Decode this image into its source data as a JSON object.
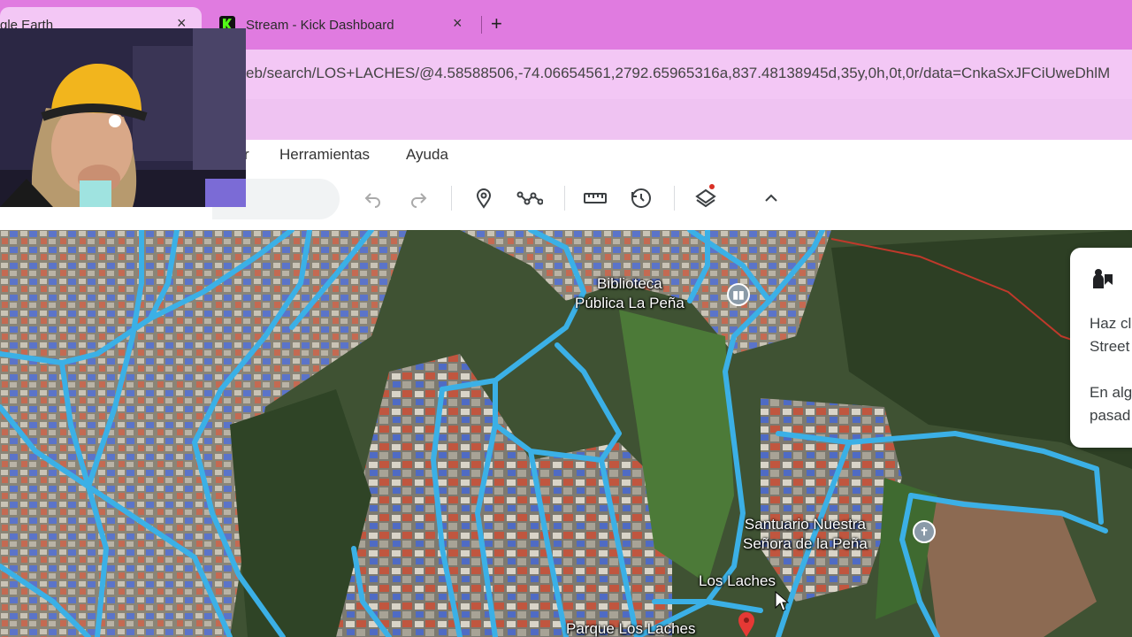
{
  "browser": {
    "tabs": [
      {
        "title": "gle Earth",
        "active": true
      },
      {
        "title": "Stream - Kick Dashboard",
        "active": false
      }
    ],
    "new_tab_glyph": "+",
    "close_glyph": "×",
    "url": "eb/search/LOS+LACHES/@4.58588506,-74.06654561,2792.65965316a,837.48138945d,35y,0h,0t,0r/data=CnkaSxJFCiUweDhlM"
  },
  "menu": {
    "partial_item": "r",
    "items": [
      "Herramientas",
      "Ayuda"
    ]
  },
  "toolbar": {
    "icons": [
      "undo-icon",
      "redo-icon",
      "placemark-icon",
      "path-icon",
      "ruler-icon",
      "history-icon",
      "layers-icon",
      "chevron-up-icon"
    ],
    "layers_notification_color": "#d93025"
  },
  "map": {
    "labels": {
      "library": "Biblioteca\nPública La Peña",
      "sanctuary": "Santuario Nuestra\nSeñora de la Peña",
      "neighborhood": "Los Laches",
      "park": "Parque Los Laches"
    },
    "road_color": "#3bb0e6",
    "pin_color": "#e53935"
  },
  "info_card": {
    "lines": [
      "Haz cl",
      "Street",
      "En alg",
      "pasad"
    ]
  }
}
